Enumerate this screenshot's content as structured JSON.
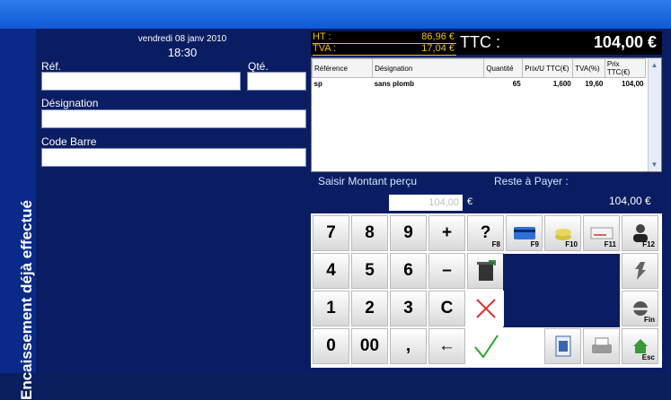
{
  "header": {
    "date": "vendredi 08 janv 2010",
    "time": "18:30"
  },
  "sidebar": {
    "text": "Encaissement déjà effectué"
  },
  "form": {
    "ref_label": "Réf.",
    "qty_label": "Qté.",
    "designation_label": "Désignation",
    "barcode_label": "Code Barre",
    "ref_value": "",
    "qty_value": "",
    "designation_value": "",
    "barcode_value": ""
  },
  "totals": {
    "ht_label": "HT :",
    "ht_value": "86,96 €",
    "tva_label": "TVA :",
    "tva_value": "17,04 €",
    "ttc_label": "TTC :",
    "ttc_value": "104,00 €"
  },
  "grid": {
    "columns": [
      "Référence",
      "Désignation",
      "Quantité",
      "Prix/U TTC(€)",
      "TVA(%)",
      "Prix TTC(€)"
    ],
    "rows": [
      [
        "sp",
        "sans plomb",
        "65",
        "1,600",
        "19,60",
        "104,00"
      ]
    ]
  },
  "payment": {
    "amount_label": "Saisir Montant perçu",
    "amount_placeholder": "104,00",
    "currency": "€",
    "remaining_label": "Reste à Payer :",
    "remaining_value": "104,00 €"
  },
  "keypad": {
    "keys": [
      "7",
      "8",
      "9",
      "+",
      "?",
      "4",
      "5",
      "6",
      "–",
      "1",
      "2",
      "3",
      "C",
      "0",
      "00",
      ",",
      "←"
    ],
    "fkeys": [
      "F8",
      "F9",
      "F10",
      "F11",
      "F12",
      "Fin",
      "Esc"
    ]
  },
  "colors": {
    "title_bar": "#1a66df",
    "background": "#0b1d62",
    "totals_text": "#f0c000",
    "ok": "#2aa52a",
    "cancel": "#e03030"
  }
}
